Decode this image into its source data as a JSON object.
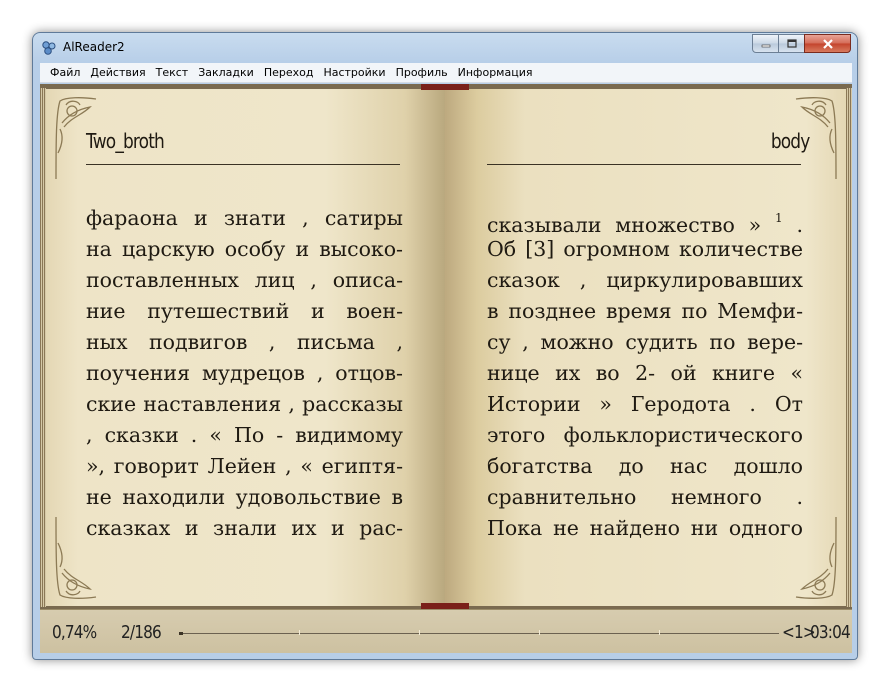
{
  "window": {
    "title": "AlReader2"
  },
  "menu": [
    "Файл",
    "Действия",
    "Текст",
    "Закладки",
    "Переход",
    "Настройки",
    "Профиль",
    "Информация"
  ],
  "book": {
    "left_header": "Two_broth",
    "right_header": "body",
    "left_lines": [
      "фараона и знати , сатиры",
      "на царскую особу и высоко-",
      "поставленных лиц , описа-",
      "ние путешествий и воен-",
      "ных подвигов , письма ,",
      "поучения мудрецов , отцов-",
      "ские наставления , рассказы",
      ", сказки . « По - видимому",
      "», говорит Лейен , « египтя-",
      "не находили удовольствие в",
      "сказках и знали их и рас-"
    ],
    "right_first_line": "сказывали множество »",
    "right_footnote": "1",
    "right_first_line_end": ".",
    "right_lines": [
      "Об [3] огромном количестве",
      "сказок , циркулировавших",
      "в позднее время по Мемфи-",
      "су , можно судить по вере-",
      "нице их во 2- ой книге «",
      "Истории » Геродота . От",
      "этого фольклористического",
      "богатства до нас дошло",
      "сравнительно немного .",
      "Пока не найдено ни одного"
    ]
  },
  "status": {
    "percent": "0,74%",
    "pages": "2/186",
    "progress_fraction": 0.0074,
    "chapter": "<1>",
    "clock": "03:04"
  },
  "colors": {
    "page": "#efe6ca",
    "text": "#1f1a12",
    "spine": "#7a2019"
  }
}
